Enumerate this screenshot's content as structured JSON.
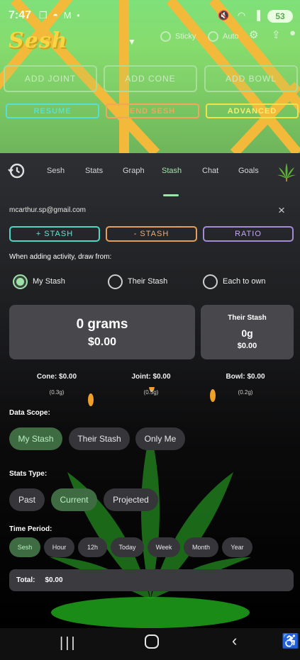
{
  "status_bar": {
    "time": "7:47",
    "left_icons": "❐ ◓ M •",
    "right_icons": "🔇 ◠ ▐",
    "battery": "53"
  },
  "header": {
    "logo": "Sesh",
    "sticky_label": "Sticky",
    "auto_label": "Auto",
    "add_joint": "ADD JOINT",
    "add_cone": "ADD CONE",
    "add_bowl": "ADD BOWL",
    "resume": "RESUME",
    "end_sesh": "END SESH",
    "advanced": "ADVANCED"
  },
  "tabs": [
    {
      "label": "Sesh"
    },
    {
      "label": "Stats"
    },
    {
      "label": "Graph"
    },
    {
      "label": "Stash"
    },
    {
      "label": "Chat"
    },
    {
      "label": "Goals"
    }
  ],
  "account": {
    "email": "mcarthur.sp@gmail.com",
    "close_icon": "×"
  },
  "stash_buttons": {
    "plus": "+ STASH",
    "minus": "- STASH",
    "ratio": "RATIO"
  },
  "draw_from": {
    "label": "When adding activity, draw from:",
    "options": [
      {
        "label": "My Stash",
        "selected": true
      },
      {
        "label": "Their Stash",
        "selected": false
      },
      {
        "label": "Each to own",
        "selected": false
      }
    ]
  },
  "my_stash": {
    "grams": "0 grams",
    "value": "$0.00"
  },
  "their_stash": {
    "title": "Their Stash",
    "grams": "0g",
    "value": "$0.00"
  },
  "costs": [
    {
      "label": "Cone: $0.00",
      "weight": "(0.3g)"
    },
    {
      "label": "Joint: $0.00",
      "weight": "(0.5g)"
    },
    {
      "label": "Bowl: $0.00",
      "weight": "(0.2g)"
    }
  ],
  "data_scope": {
    "label": "Data Scope:",
    "options": [
      "My Stash",
      "Their Stash",
      "Only Me"
    ],
    "selected": "My Stash"
  },
  "stats_type": {
    "label": "Stats Type:",
    "options": [
      "Past",
      "Current",
      "Projected"
    ],
    "selected": "Current"
  },
  "time_period": {
    "label": "Time Period:",
    "options": [
      "Sesh",
      "Hour",
      "12h",
      "Today",
      "Week",
      "Month",
      "Year"
    ],
    "selected": "Sesh"
  },
  "total": {
    "label": "Total:",
    "value": "$0.00"
  },
  "nav": {
    "menu_icon": "|||",
    "back_icon": "‹",
    "accessibility_icon": "♿"
  },
  "colors": {
    "accent_green": "#9fe3a9",
    "teal": "#4ed6c4",
    "orange": "#e49f5e",
    "purple": "#a58ad6",
    "yellow": "#f0e24a",
    "card": "#48484c"
  }
}
